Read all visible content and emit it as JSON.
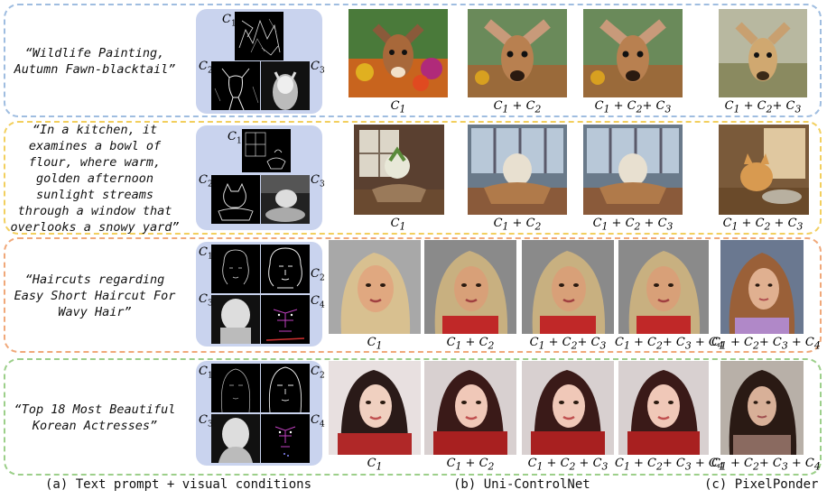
{
  "rows": [
    {
      "prompt": "“Wildlife Painting, Autumn Fawn-blacktail”",
      "border": "#9fbde0",
      "conditions": [
        "C1",
        "C2",
        "C3"
      ],
      "outputs": [
        "C1",
        "C1 + C2",
        "C1 + C2+ C3",
        "C1 + C2+ C3"
      ]
    },
    {
      "prompt": "“In a kitchen, it examines a bowl of flour, where warm, golden afternoon sunlight streams through a window that overlooks a snowy yard”",
      "border": "#f2cf5e",
      "conditions": [
        "C1",
        "C2",
        "C3"
      ],
      "outputs": [
        "C1",
        "C1 + C2",
        "C1 + C2+ C3",
        "C1 + C2+ C3"
      ]
    },
    {
      "prompt": "“Haircuts regarding Easy Short Haircut For Wavy Hair”",
      "border": "#f0a879",
      "conditions": [
        "C1",
        "C2",
        "C3",
        "C4"
      ],
      "outputs": [
        "C1",
        "C1 + C2",
        "C1 + C2+ C3",
        "C1 + C2+ C3 + C4",
        "C1 + C2+ C3 + C4"
      ]
    },
    {
      "prompt": "“Top 18 Most Beautiful Korean Actresses”",
      "border": "#9ccf8a",
      "conditions": [
        "C1",
        "C2",
        "C3",
        "C4"
      ],
      "outputs": [
        "C1",
        "C1 + C2",
        "C1 + C2+ C3",
        "C1 + C2+ C3 + C4",
        "C1 + C2+ C3 + C4"
      ]
    }
  ],
  "captions": {
    "a": "(a) Text prompt + visual conditions",
    "b": "(b) Uni-ControlNet",
    "c": "(c) PixelPonder"
  }
}
